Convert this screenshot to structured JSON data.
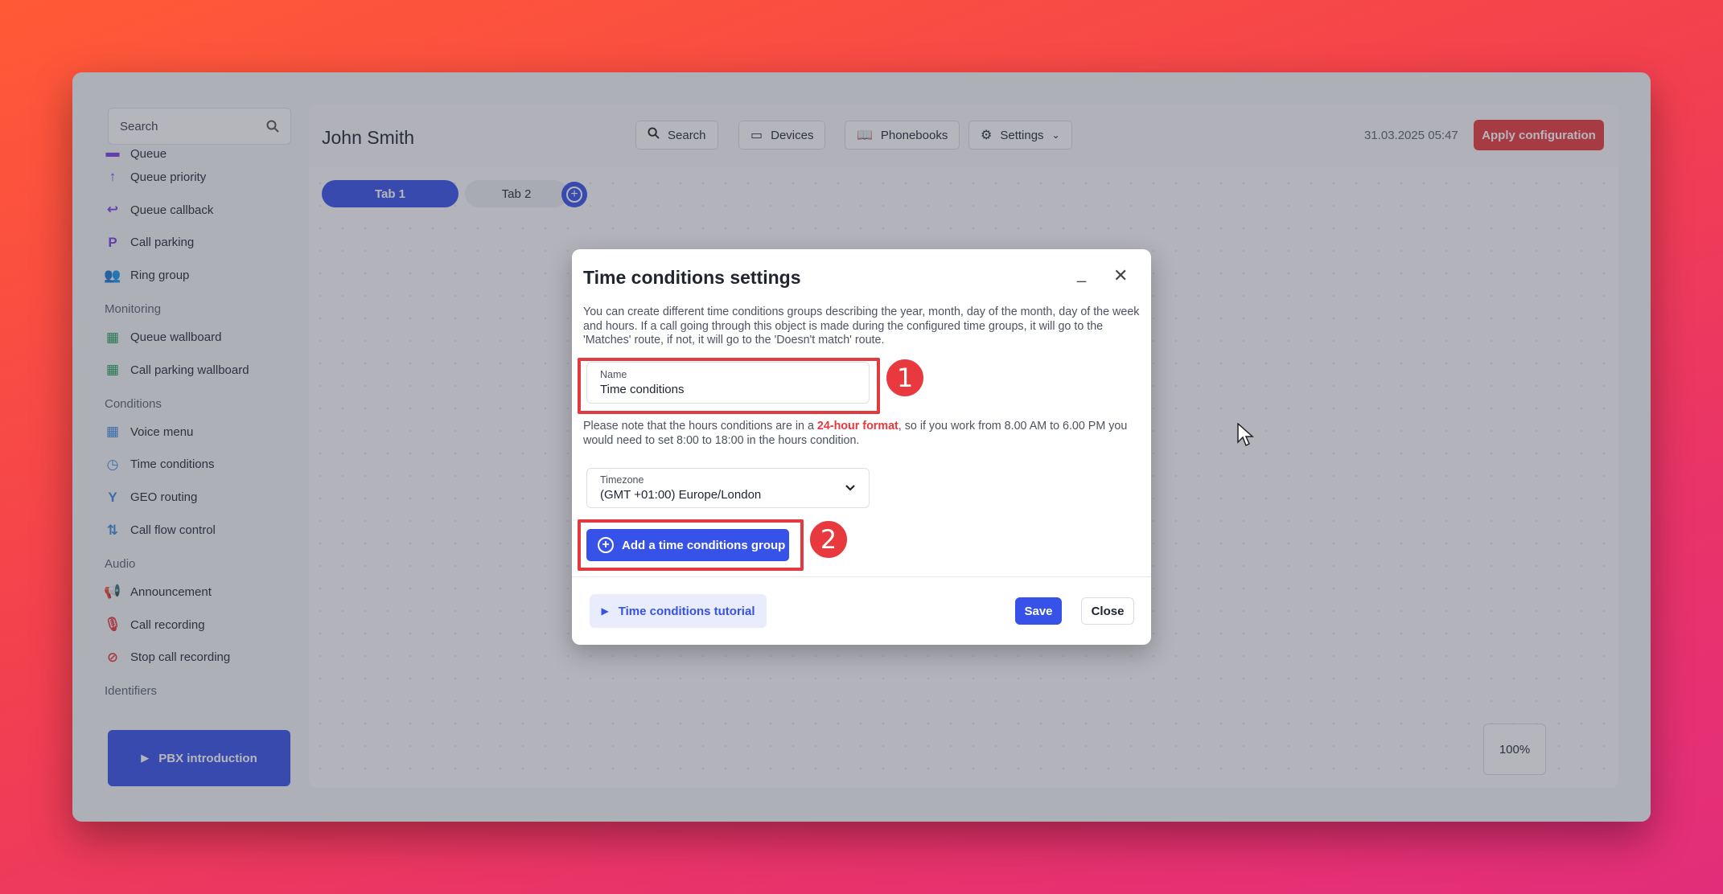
{
  "sidebar": {
    "search_placeholder": "Search",
    "items": [
      {
        "label": "Queue",
        "icon": "queue-icon",
        "color": "#7b3fe4"
      },
      {
        "label": "Queue priority",
        "icon": "arrow-up-icon",
        "color": "#7b3fe4"
      },
      {
        "label": "Queue callback",
        "icon": "callback-icon",
        "color": "#7b3fe4"
      },
      {
        "label": "Call parking",
        "icon": "parking-icon",
        "color": "#7b3fe4"
      },
      {
        "label": "Ring group",
        "icon": "group-icon",
        "color": "#7b3fe4"
      }
    ],
    "sections": {
      "monitoring": "Monitoring",
      "conditions": "Conditions",
      "audio": "Audio",
      "identifiers": "Identifiers"
    },
    "monitoring_items": [
      {
        "label": "Queue wallboard",
        "icon": "dashboard-icon",
        "color": "#1f9d57"
      },
      {
        "label": "Call parking wallboard",
        "icon": "dashboard-icon",
        "color": "#1f9d57"
      }
    ],
    "conditions_items": [
      {
        "label": "Voice menu",
        "icon": "grid-icon",
        "color": "#3b8be0"
      },
      {
        "label": "Time conditions",
        "icon": "clock-icon",
        "color": "#3b8be0"
      },
      {
        "label": "GEO routing",
        "icon": "fork-icon",
        "color": "#3b8be0"
      },
      {
        "label": "Call flow control",
        "icon": "flow-icon",
        "color": "#3b8be0"
      }
    ],
    "audio_items": [
      {
        "label": "Announcement",
        "icon": "megaphone-icon",
        "color": "#e8393e"
      },
      {
        "label": "Call recording",
        "icon": "mic-icon",
        "color": "#e8393e"
      },
      {
        "label": "Stop call recording",
        "icon": "mic-off-icon",
        "color": "#e8393e"
      }
    ],
    "pbx_button": "PBX introduction"
  },
  "header": {
    "user_name": "John Smith",
    "search_label": "Search",
    "devices_label": "Devices",
    "phonebooks_label": "Phonebooks",
    "settings_label": "Settings",
    "datetime": "31.03.2025 05:47",
    "apply_label": "Apply configuration"
  },
  "tabs": [
    "Tab 1",
    "Tab 2"
  ],
  "zoom": "100%",
  "modal": {
    "title": "Time conditions settings",
    "description": "You can create different time conditions groups describing the year, month, day of the month, day of the week and hours. If a call going through this object is made during the configured time groups, it will go to the 'Matches' route, if not, it will go to the 'Doesn't match' route.",
    "name_label": "Name",
    "name_value": "Time conditions",
    "note_before": "Please note that the hours conditions are in a ",
    "note_highlight": "24-hour format",
    "note_after": ", so if you work from 8.00 AM to 6.00 PM you would need to set 8:00 to 18:00 in the hours condition.",
    "timezone_label": "Timezone",
    "timezone_value": "(GMT +01:00) Europe/London",
    "add_group_label": "Add a time conditions group",
    "tutorial_label": "Time conditions tutorial",
    "save_label": "Save",
    "close_label": "Close"
  },
  "annotations": [
    "1",
    "2"
  ],
  "colors": {
    "accent": "#3752e8",
    "danger": "#e8393e",
    "highlight_border": "#e13a3f"
  }
}
